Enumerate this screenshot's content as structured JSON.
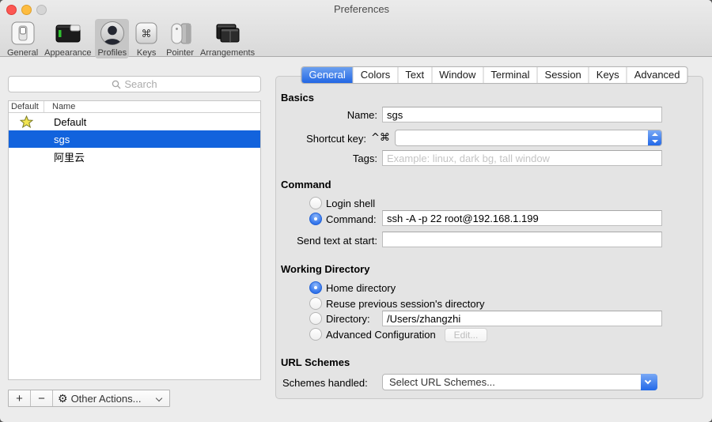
{
  "window": {
    "title": "Preferences"
  },
  "toolbar": {
    "selected": "Profiles",
    "items": [
      {
        "label": "General",
        "icon": "switch-icon"
      },
      {
        "label": "Appearance",
        "icon": "appearance-window-icon"
      },
      {
        "label": "Profiles",
        "icon": "person-icon"
      },
      {
        "label": "Keys",
        "icon": "command-key-icon"
      },
      {
        "label": "Pointer",
        "icon": "mouse-icon"
      },
      {
        "label": "Arrangements",
        "icon": "stacked-windows-icon"
      }
    ]
  },
  "sidebar": {
    "search": {
      "placeholder": "Search"
    },
    "list": {
      "columns": [
        "Default",
        "Name"
      ],
      "rows": [
        {
          "name": "Default",
          "is_default": true,
          "selected": false
        },
        {
          "name": "sgs",
          "is_default": false,
          "selected": true
        },
        {
          "name": "阿里云",
          "is_default": false,
          "selected": false
        }
      ]
    },
    "actions": {
      "add": "+",
      "remove": "−",
      "other": "Other Actions..."
    }
  },
  "tabs": {
    "selected": "General",
    "items": [
      {
        "label": "General"
      },
      {
        "label": "Colors"
      },
      {
        "label": "Text"
      },
      {
        "label": "Window"
      },
      {
        "label": "Terminal"
      },
      {
        "label": "Session"
      },
      {
        "label": "Keys"
      },
      {
        "label": "Advanced"
      }
    ]
  },
  "panel": {
    "basics": {
      "heading": "Basics",
      "name_label": "Name:",
      "name_value": "sgs",
      "shortcut_label": "Shortcut key:",
      "shortcut_modifiers": "^⌘",
      "shortcut_value": "",
      "tags_label": "Tags:",
      "tags_placeholder": "Example: linux, dark bg, tall window"
    },
    "command": {
      "heading": "Command",
      "login_shell_label": "Login shell",
      "command_label": "Command:",
      "command_value": "ssh -A -p 22 root@192.168.1.199",
      "send_text_label": "Send text at start:",
      "send_text_value": ""
    },
    "working_directory": {
      "heading": "Working Directory",
      "home_label": "Home directory",
      "reuse_label": "Reuse previous session's directory",
      "directory_label": "Directory:",
      "directory_value": "/Users/zhangzhi",
      "advanced_label": "Advanced Configuration",
      "edit_button": "Edit..."
    },
    "url_schemes": {
      "heading": "URL Schemes",
      "handled_label": "Schemes handled:",
      "selected_value": "Select URL Schemes..."
    }
  },
  "colors": {
    "accent_blue": "#2268e8",
    "selection_blue": "#1263dd",
    "tab_selected_top": "#6ca0f0",
    "tab_selected_bottom": "#2267e4"
  }
}
